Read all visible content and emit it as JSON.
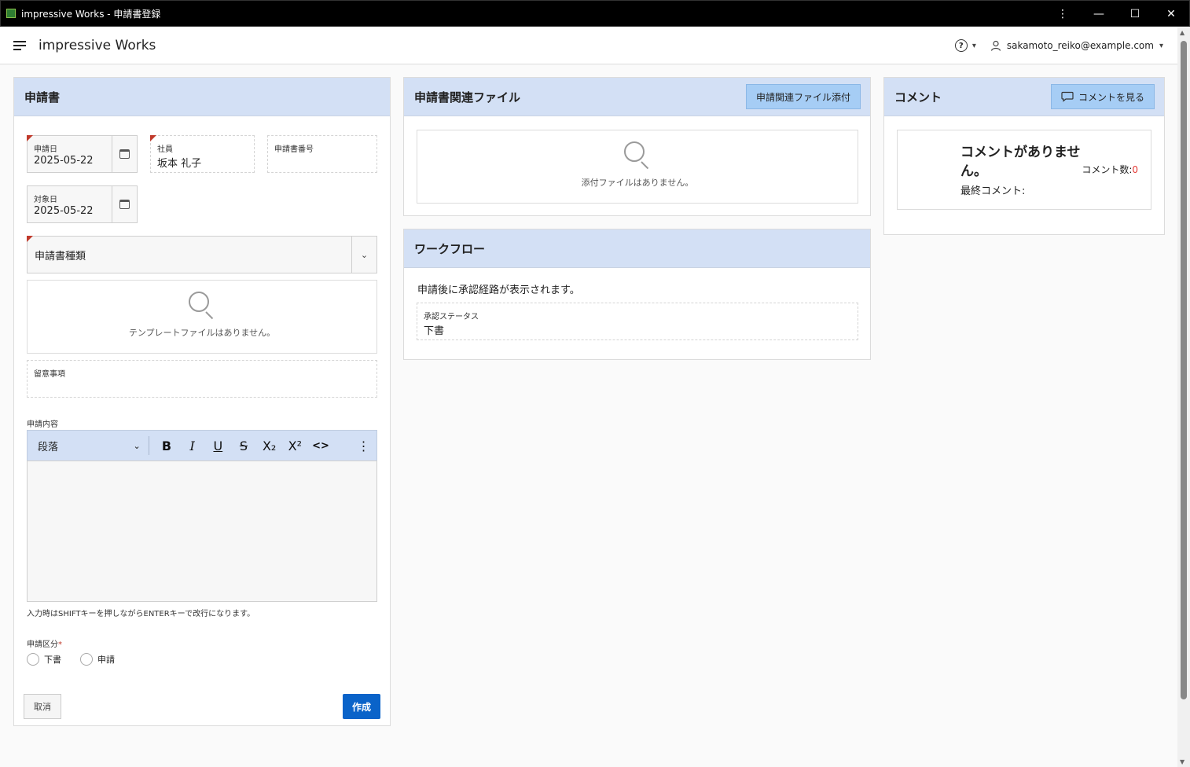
{
  "window": {
    "title": "impressive Works - 申請書登録",
    "controls": [
      "⋮",
      "—",
      "☐",
      "✕"
    ]
  },
  "header": {
    "app_name": "impressive Works",
    "help": "?",
    "user_email": "sakamoto_reiko@example.com"
  },
  "application_form": {
    "title": "申請書",
    "apply_date": {
      "label": "申請日",
      "value": "2025-05-22"
    },
    "employee": {
      "label": "社員",
      "value": "坂本 礼子"
    },
    "form_number": {
      "label": "申請書番号",
      "value": ""
    },
    "target_date": {
      "label": "対象日",
      "value": "2025-05-22"
    },
    "form_type": {
      "placeholder": "申請書種類"
    },
    "template_empty": "テンプレートファイルはありません。",
    "notes": {
      "label": "留意事項",
      "value": ""
    },
    "content": {
      "label": "申請内容",
      "paragraph": "段落",
      "toolbar": [
        "B",
        "I",
        "U",
        "S",
        "X₂",
        "X²",
        "<>",
        "⋮"
      ],
      "hint": "入力時はSHIFTキーを押しながらENTERキーで改行になります。"
    },
    "category": {
      "label": "申請区分",
      "required_mark": "*",
      "options": [
        "下書",
        "申請"
      ]
    },
    "cancel": "取消",
    "create": "作成"
  },
  "files_panel": {
    "title": "申請書関連ファイル",
    "attach_button": "申請関連ファイル添付",
    "empty": "添付ファイルはありません。"
  },
  "workflow_panel": {
    "title": "ワークフロー",
    "message": "申請後に承認経路が表示されます。",
    "status": {
      "label": "承認ステータス",
      "value": "下書"
    }
  },
  "comment_panel": {
    "title": "コメント",
    "view_button": "コメントを見る",
    "no_comments_line1": "コメントがありませ",
    "no_comments_line2": "ん。",
    "last_comment_label": "最終コメント:",
    "count_label": "コメント数:",
    "count_value": "0"
  },
  "colors": {
    "panel_header": "#d3e0f5",
    "primary": "#0a63c9",
    "required": "#c0392b",
    "count": "#e53935"
  }
}
